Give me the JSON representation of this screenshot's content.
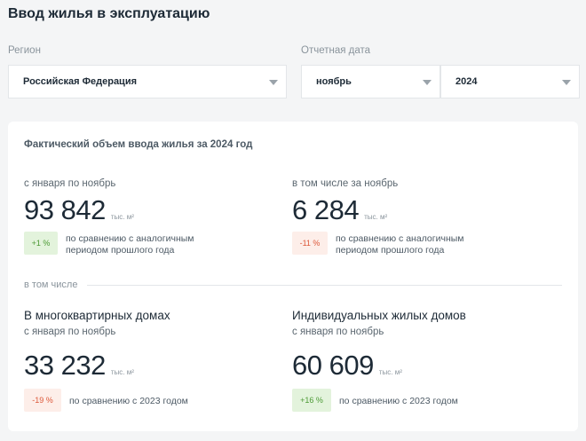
{
  "header": {
    "title": "Ввод жилья в эксплуатацию"
  },
  "filters": {
    "region_label": "Регион",
    "region_value": "Российская Федерация",
    "date_label": "Отчетная дата",
    "month_value": "ноябрь",
    "year_value": "2024"
  },
  "card": {
    "title": "Фактический объем ввода жилья за 2024 год",
    "total": {
      "period": "с января по ноябрь",
      "value": "93 842",
      "unit": "тыс. м²",
      "change": "+1 %",
      "note_line1": "по сравнению с аналогичным",
      "note_line2": "периодом прошлого года"
    },
    "month": {
      "period": "в том числе за ноябрь",
      "value": "6 284",
      "unit": "тыс. м²",
      "change": "-11 %",
      "note_line1": "по сравнению с аналогичным",
      "note_line2": "периодом прошлого года"
    },
    "section_label": "в том числе",
    "apartments": {
      "heading": "В многоквартирных домах",
      "period": "с января по ноябрь",
      "value": "33 232",
      "unit": "тыс. м²",
      "change": "-19 %",
      "note": "по сравнению с 2023 годом"
    },
    "individual": {
      "heading": "Индивидуальных жилых домов",
      "period": "с января по ноябрь",
      "value": "60 609",
      "unit": "тыс. м²",
      "change": "+16 %",
      "note": "по сравнению с 2023 годом"
    }
  },
  "colors": {
    "positive_bg": "#e3f3dc",
    "positive_text": "#4c9a35",
    "negative_bg": "#fdeee9",
    "negative_text": "#dd5a3c"
  },
  "icons": {
    "dropdown": "chevron-down-icon"
  }
}
